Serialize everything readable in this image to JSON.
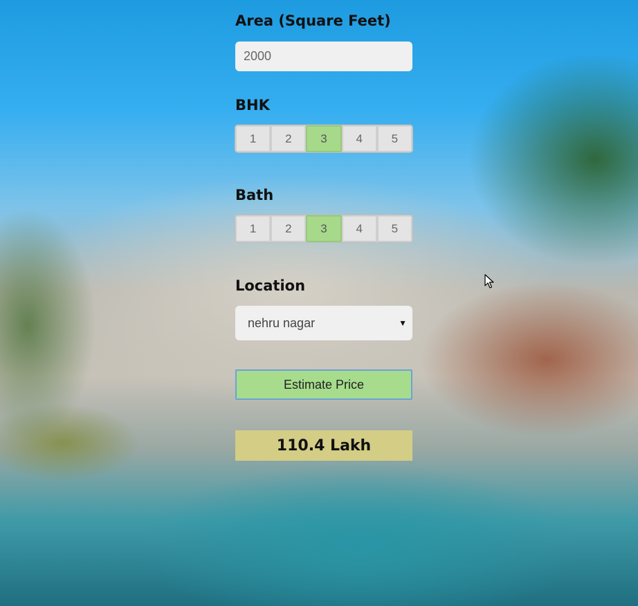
{
  "area": {
    "label": "Area (Square Feet)",
    "value": "2000"
  },
  "bhk": {
    "label": "BHK",
    "options": [
      "1",
      "2",
      "3",
      "4",
      "5"
    ],
    "selected": "3"
  },
  "bath": {
    "label": "Bath",
    "options": [
      "1",
      "2",
      "3",
      "4",
      "5"
    ],
    "selected": "3"
  },
  "location": {
    "label": "Location",
    "selected": "nehru nagar"
  },
  "estimate_button": {
    "label": "Estimate Price"
  },
  "result": {
    "text": "110.4 Lakh"
  },
  "colors": {
    "active_option": "#a6d98a",
    "button_bg": "#a6dc8c",
    "result_bg": "#d3cd86"
  }
}
